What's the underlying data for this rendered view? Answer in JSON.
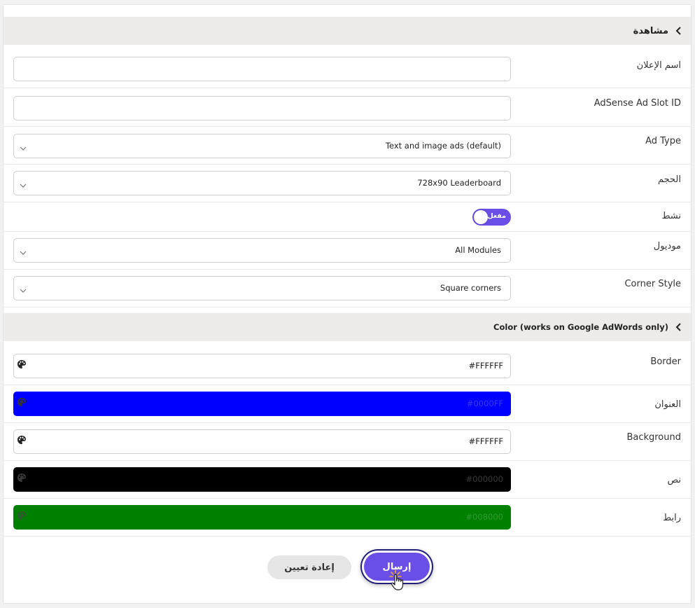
{
  "sections": {
    "preview": {
      "title": "مشاهدة"
    },
    "color": {
      "title": "Color (works on Google AdWords only)"
    }
  },
  "fields": {
    "ad_name": {
      "label": "اسم الإعلان",
      "value": ""
    },
    "slot_id": {
      "label": "AdSense Ad Slot ID",
      "value": ""
    },
    "ad_type": {
      "label": "Ad Type",
      "value": "Text and image ads (default)"
    },
    "size": {
      "label": "الحجم",
      "value": "728x90 Leaderboard"
    },
    "active": {
      "label": "نشط",
      "toggle_text": "مفعل",
      "state": "on"
    },
    "module": {
      "label": "موديول",
      "value": "All Modules"
    },
    "corner_style": {
      "label": "Corner Style",
      "value": "Square corners"
    }
  },
  "colors": {
    "border": {
      "label": "Border",
      "value": "#FFFFFF"
    },
    "title": {
      "label": "العنوان",
      "value": "#0000FF"
    },
    "background": {
      "label": "Background",
      "value": "#FFFFFF"
    },
    "text": {
      "label": "نص",
      "value": "#000000"
    },
    "link": {
      "label": "رابط",
      "value": "#008000"
    }
  },
  "buttons": {
    "reset": "إعادة تعيين",
    "submit": "إرسال"
  },
  "theme": {
    "accent": "#6a4ee6",
    "header_bg": "#edecea"
  }
}
